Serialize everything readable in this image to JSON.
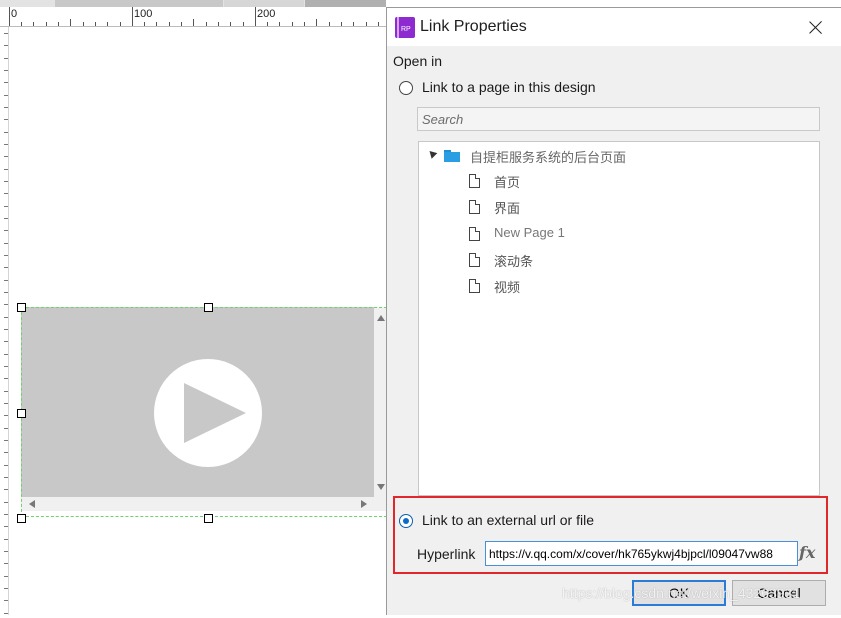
{
  "ruler": {
    "labels": [
      "0",
      "100",
      "200"
    ]
  },
  "dialog": {
    "title": "Link Properties",
    "icon": "axure-rp-icon",
    "open_in_label": "Open in",
    "option_page_label": "Link to a page in this design",
    "search_placeholder": "Search",
    "tree": {
      "root_label": "自提柜服务系统的后台页面",
      "pages": [
        "首页",
        "界面",
        "New Page 1",
        "滚动条",
        "视频"
      ]
    },
    "option_external_label": "Link to an external url or file",
    "selected_option": "external",
    "hyperlink_label": "Hyperlink",
    "hyperlink_value": "https://v.qq.com/x/cover/hk765ykwj4bjpcl/l09047vw88",
    "fx_label": "fx",
    "ok_label": "OK",
    "cancel_label": "Cancel"
  },
  "canvas": {
    "widget": "video-player",
    "accent_selection_color": "#6dd36d"
  },
  "highlight_color": "#e0282c",
  "watermark": "https://blog.csdn.net/weixin_43263931"
}
